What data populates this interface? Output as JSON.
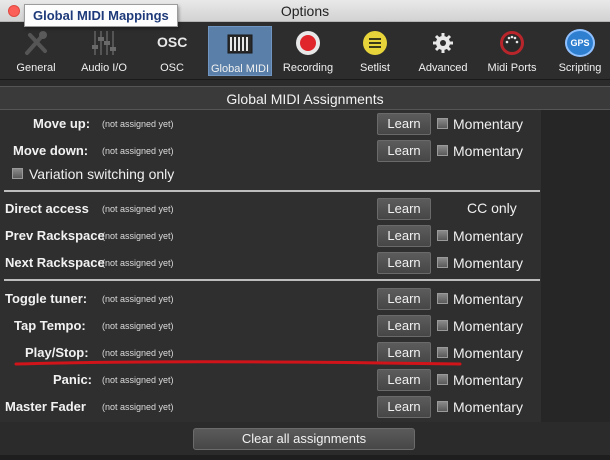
{
  "window": {
    "title": "Options"
  },
  "tooltip": {
    "text": "Global MIDI Mappings"
  },
  "toolbar": {
    "tabs": [
      {
        "label": "General",
        "icon": "tools-icon"
      },
      {
        "label": "Audio I/O",
        "icon": "mixer-faders-icon"
      },
      {
        "label": "OSC",
        "icon": "osc-icon",
        "icon_text": "OSC"
      },
      {
        "label": "Global MIDI",
        "icon": "piano-keyboard-icon",
        "active": true
      },
      {
        "label": "Recording",
        "icon": "record-icon"
      },
      {
        "label": "Setlist",
        "icon": "setlist-icon"
      },
      {
        "label": "Advanced",
        "icon": "gear-icon"
      },
      {
        "label": "Midi Ports",
        "icon": "midi-port-icon"
      },
      {
        "label": "Scripting",
        "icon": "gps-script-icon",
        "icon_text": "GPS"
      }
    ]
  },
  "section": {
    "title": "Global MIDI Assignments"
  },
  "status_text": "(not assigned yet)",
  "learn_label": "Learn",
  "momentary_label": "Momentary",
  "groups": {
    "navigation": {
      "move_up": "Move up:",
      "move_down": "Move down:",
      "variation_switching": "Variation switching only"
    },
    "access": {
      "direct_access": "Direct access",
      "cc_only": "CC only",
      "prev_rackspace": "Prev Rackspace",
      "next_rackspace": "Next Rackspace"
    },
    "transport": {
      "toggle_tuner": "Toggle tuner:",
      "tap_tempo": "Tap Tempo:",
      "play_stop": "Play/Stop:",
      "panic": "Panic:",
      "master_fader": "Master Fader"
    }
  },
  "footer": {
    "clear_label": "Clear all assignments"
  },
  "colors": {
    "active_tab": "#5a7fa8",
    "annotation_stroke": "#d0141a"
  }
}
